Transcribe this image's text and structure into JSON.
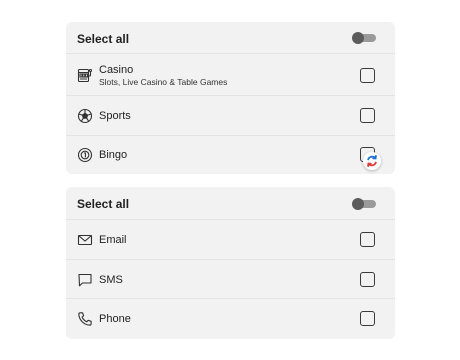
{
  "products_card": {
    "select_all_label": "Select all",
    "items": [
      {
        "label": "Casino",
        "sublabel": "Slots, Live Casino & Table Games",
        "icon": "slot-machine-icon",
        "checked": false
      },
      {
        "label": "Sports",
        "icon": "football-icon",
        "checked": false
      },
      {
        "label": "Bingo",
        "icon": "bingo-ball-icon",
        "checked": false,
        "loading": true
      }
    ]
  },
  "channels_card": {
    "select_all_label": "Select all",
    "items": [
      {
        "label": "Email",
        "icon": "envelope-icon",
        "checked": false
      },
      {
        "label": "SMS",
        "icon": "chat-bubble-icon",
        "checked": false
      },
      {
        "label": "Phone",
        "icon": "phone-icon",
        "checked": false
      }
    ]
  },
  "colors": {
    "card_background": "#f2f2f2",
    "toggle_knob": "#5c5c5c",
    "toggle_track": "#9a9a9a",
    "spinner_blue": "#1e6fd9",
    "spinner_red": "#e53935"
  }
}
